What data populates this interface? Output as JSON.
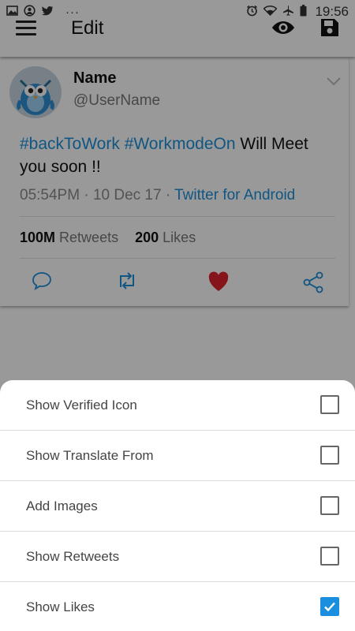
{
  "status_bar": {
    "time": "19:56",
    "dots": "···",
    "left_icons": [
      "image-icon",
      "at-icon",
      "twitter-icon"
    ],
    "right_icons": [
      "alarm-icon",
      "wifi-icon",
      "airplane-icon",
      "battery-icon"
    ]
  },
  "app_bar": {
    "title": "Edit",
    "icons": [
      "menu-icon",
      "eye-icon",
      "save-icon"
    ]
  },
  "tweet": {
    "name": "Name",
    "handle": "@UserName",
    "hashtag1": "#backToWork",
    "hashtag2": "#WorkmodeOn",
    "text_rest": "Will Meet you soon !!",
    "time": "05:54PM",
    "sep": "·",
    "date": "10 Dec 17",
    "source": "Twitter for Android",
    "retweets_count": "100M",
    "retweets_label": "Retweets",
    "likes_count": "200",
    "likes_label": "Likes",
    "like_color": "#e0232e",
    "link_color": "#1d8fdb"
  },
  "options": [
    {
      "label": "Show Verified Icon",
      "checked": false
    },
    {
      "label": "Show Translate From",
      "checked": false
    },
    {
      "label": "Add Images",
      "checked": false
    },
    {
      "label": "Show Retweets",
      "checked": false
    },
    {
      "label": "Show Likes",
      "checked": true
    }
  ],
  "checkbox_color": "#1a8fe0"
}
